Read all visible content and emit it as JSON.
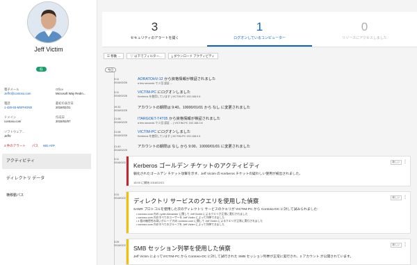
{
  "user": {
    "name": "Jeff Victim",
    "badge": "低",
    "email_label": "電子メール",
    "email": "JeffV@contoso.com",
    "office_label": "Office",
    "office": "Microsoft Way Redm...",
    "phone_label": "電話",
    "phone": "1-425-93-MSPHONE",
    "created_label": "最初の表示日",
    "created": "2018/02/21",
    "domain_label": "ドメイン",
    "domain": "contoso.com",
    "lastseen_label": "作成日",
    "lastseen": "2018/02/07",
    "sw_label": "ソフトウェア...",
    "sw": "JeffV",
    "tags": [
      "3 件のアラート",
      "パス",
      "WD ATP"
    ]
  },
  "sidenav": [
    "アクティビティ",
    "ディレクトリ データ",
    "横移動パス"
  ],
  "stats": [
    {
      "num": "3",
      "label": "セキュリティのアラートを開く"
    },
    {
      "num": "1",
      "label": "ログオンしているコンピューター"
    },
    {
      "num": "0",
      "label": "リソースにアクセスしました"
    }
  ],
  "toolbar": {
    "move": "移動 ...",
    "filter": "以下でフィルター...",
    "download": "ダウンロード アクティビティ"
  },
  "pill": "今日",
  "events": [
    {
      "time": "3:11",
      "date": "2018/02/26",
      "pre": "",
      "link": "AORATOHV-12",
      "post": " から資格情報が検証されました",
      "sub": "a few seconds で 2 回 認証 ..."
    },
    {
      "time": "3:11",
      "date": "2018/02/26",
      "pre": "",
      "link": "VICTIM-PC",
      "post": " にログオンしました",
      "sub": "Kerberos を使用しています | VICTIM-PC 192.168.0.6"
    },
    {
      "time": "19:32",
      "date": "2018/02/25",
      "pre": "アカウントの期限は 9:40、10000/01/01 から なし に変更されました",
      "link": "",
      "post": "",
      "sub": ""
    },
    {
      "time": "21:08",
      "date": "2018/02/25",
      "pre": "",
      "link": "ITARGOET-T4T05",
      "post": " から資格情報が検証されました",
      "sub": "a few seconds で 2 回 認証 ... | VICTIM-PC 192.168.0.6"
    },
    {
      "time": "21:08",
      "date": "2018/02/25",
      "pre": "",
      "link": "VICTIM-PC",
      "post": " にログオンしました",
      "sub": "Kerberos を使用しています | VICTIM-PC 192.168.0.6"
    },
    {
      "time": "21:40",
      "date": "2018/02/25",
      "pre": "アカウントの期限は なし から 9:00、10000/01/01 に変更されました",
      "link": "",
      "post": "",
      "sub": ""
    }
  ],
  "cards": [
    {
      "time": "3:11",
      "date": "2018/02/21",
      "color": "#c4262e",
      "title": "Kerberos ゴールデン チケットのアクティビティ",
      "body": "弱化されたゴールデン チケット攻撃を示す、Jeff Victim の Kerberos チケットの疑わしい使用が検出されました。",
      "foot": "18:00 に開始 2018/02/21",
      "tag": "新しい",
      "list": []
    },
    {
      "time": "3:31",
      "date": "2018/02/21",
      "color": "#f2c200",
      "title": "ディレクトリ サービスのクエリを使用した偵察",
      "body": "SAMR プロトコルを使用した次のディレクトリ サービスのクエリが VICTIM-PC から Contoso-DC に対して試みられました:",
      "foot": "",
      "tag": "新しい",
      "list": [
        "contoso.com 内の Lydie Alexander に関して Jeff Victim によるクエリが正常に実行されました",
        "contoso.com 内のすべてのユーザーを Jeff Victim によって列挙できました",
        "4 個の機密性の高いグループ 内の contoso.com に関して Jeff Victim によるクエリが正常に実行されました",
        "contoso.com 内のすべてのグループを Jeff Victim によって列挙できました"
      ]
    },
    {
      "time": "3:26",
      "date": "2018/02/21",
      "color": "#f2c200",
      "title": "SMB セッション列挙を使用した偵察",
      "body": "Jeff Victim によってVICTIM-PC から Contoso-DC に対して試行された SMB セッション列挙が正常に実行され、2 アカウント が公開されています。",
      "foot": "",
      "tag": "新しい",
      "list": []
    }
  ]
}
